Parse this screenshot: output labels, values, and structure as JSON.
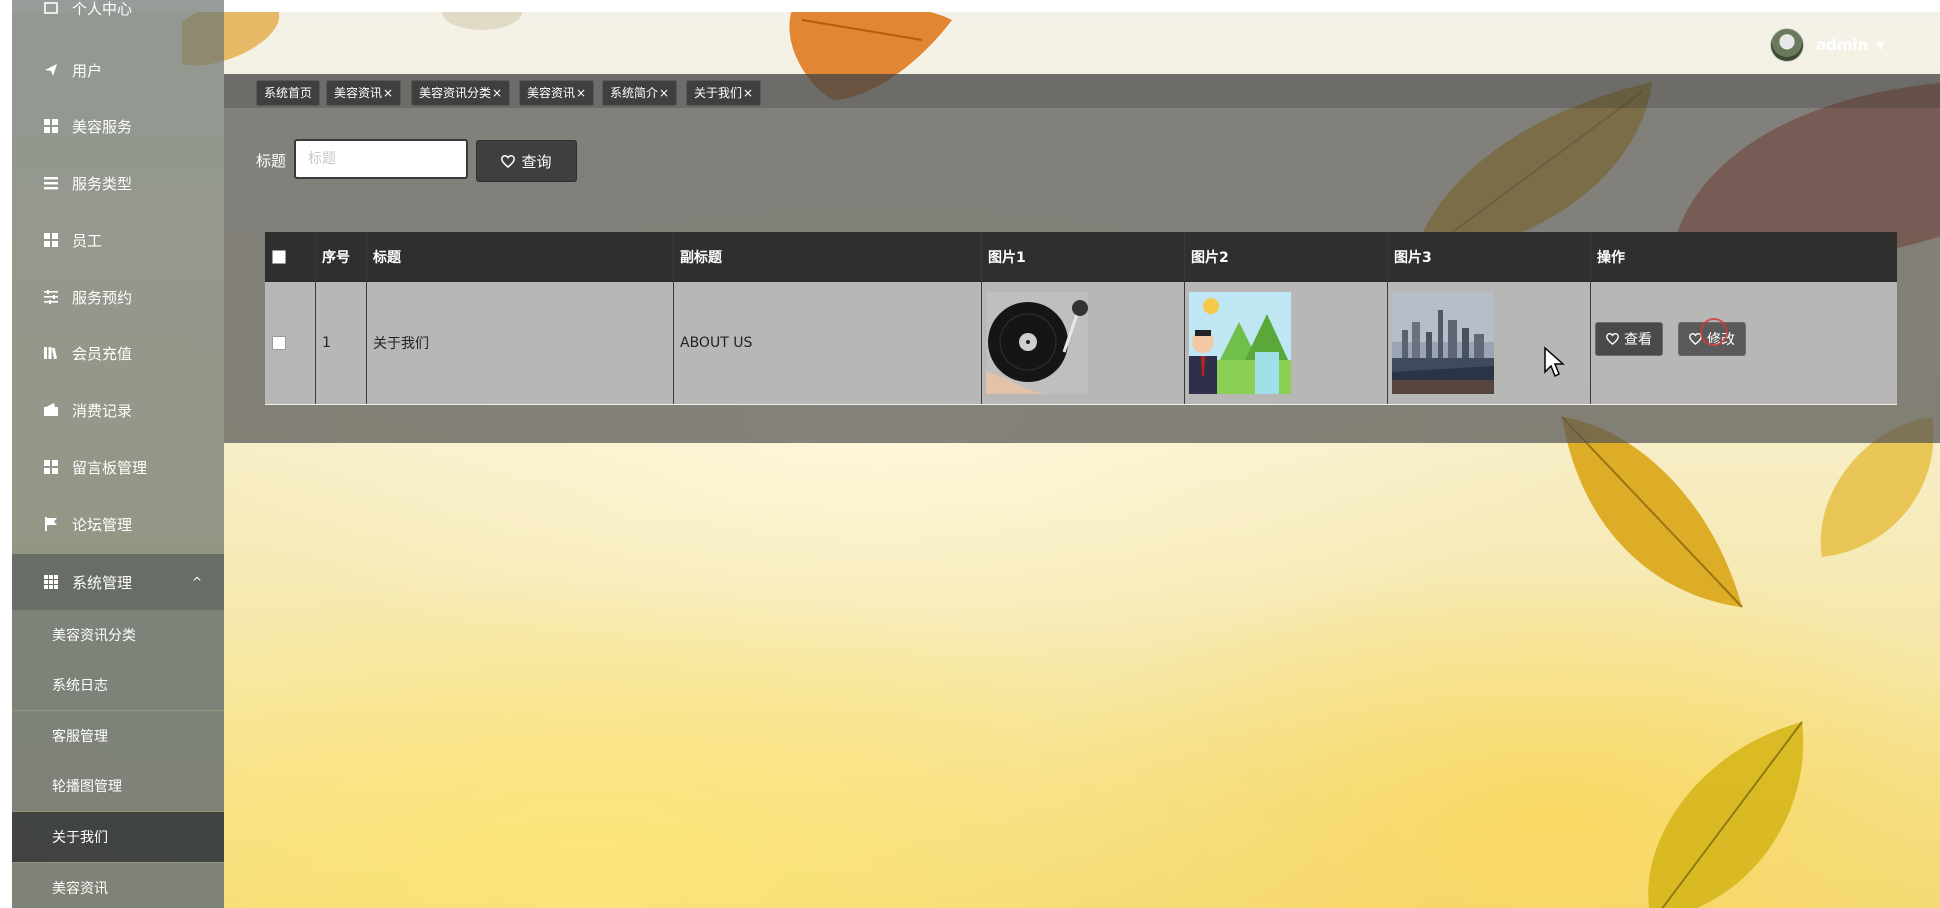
{
  "colors": {
    "sidebar_bg": "#6e7670",
    "active_sub_item": "#373c3c",
    "header_bar": "#464646",
    "tag_bg": "#3f3f3f",
    "table_header": "#2f302e",
    "table_row": "#bebebe",
    "button_dark": "#3f3f3f"
  },
  "sidebar": {
    "top_partial_label": "个人中心",
    "items": [
      {
        "label": "用户",
        "icon": "send-icon"
      },
      {
        "label": "美容服务",
        "icon": "grid-icon"
      },
      {
        "label": "服务类型",
        "icon": "list-icon"
      },
      {
        "label": "员工",
        "icon": "grid-icon"
      },
      {
        "label": "服务预约",
        "icon": "sliders-icon"
      },
      {
        "label": "会员充值",
        "icon": "library-icon"
      },
      {
        "label": "消费记录",
        "icon": "wallet-icon"
      },
      {
        "label": "留言板管理",
        "icon": "grid-icon"
      },
      {
        "label": "论坛管理",
        "icon": "flag-icon"
      }
    ],
    "expanded": {
      "label": "系统管理",
      "icon": "grid-icon",
      "caret": "^",
      "sub_items": [
        {
          "label": "美容资讯分类",
          "active": false
        },
        {
          "label": "系统日志",
          "active": false
        },
        {
          "label": "客服管理",
          "active": false
        },
        {
          "label": "轮播图管理",
          "active": false
        },
        {
          "label": "关于我们",
          "active": true
        },
        {
          "label": "美容资讯",
          "active": false
        }
      ]
    }
  },
  "tabs": [
    {
      "label": "系统首页",
      "closable": false
    },
    {
      "label": "美容资讯",
      "closable": true
    },
    {
      "label": "美容资讯分类",
      "closable": true
    },
    {
      "label": "美容资讯",
      "closable": true
    },
    {
      "label": "系统简介",
      "closable": true
    },
    {
      "label": "关于我们",
      "closable": true
    }
  ],
  "tab_close_glyph": "×",
  "user": {
    "name": "admin",
    "dropdown_glyph": "▼"
  },
  "search": {
    "label": "标题",
    "placeholder": "标题",
    "value": "",
    "button_label": "查询"
  },
  "table": {
    "columns": [
      "",
      "序号",
      "标题",
      "副标题",
      "图片1",
      "图片2",
      "图片3",
      "操作"
    ],
    "rows": [
      {
        "index": "1",
        "title": "关于我们",
        "subtitle": "ABOUT US",
        "image1": "turntable-image",
        "image2": "cartoon-person-image",
        "image3": "city-skyline-image",
        "actions": {
          "view": "查看",
          "edit": "修改"
        }
      }
    ]
  }
}
